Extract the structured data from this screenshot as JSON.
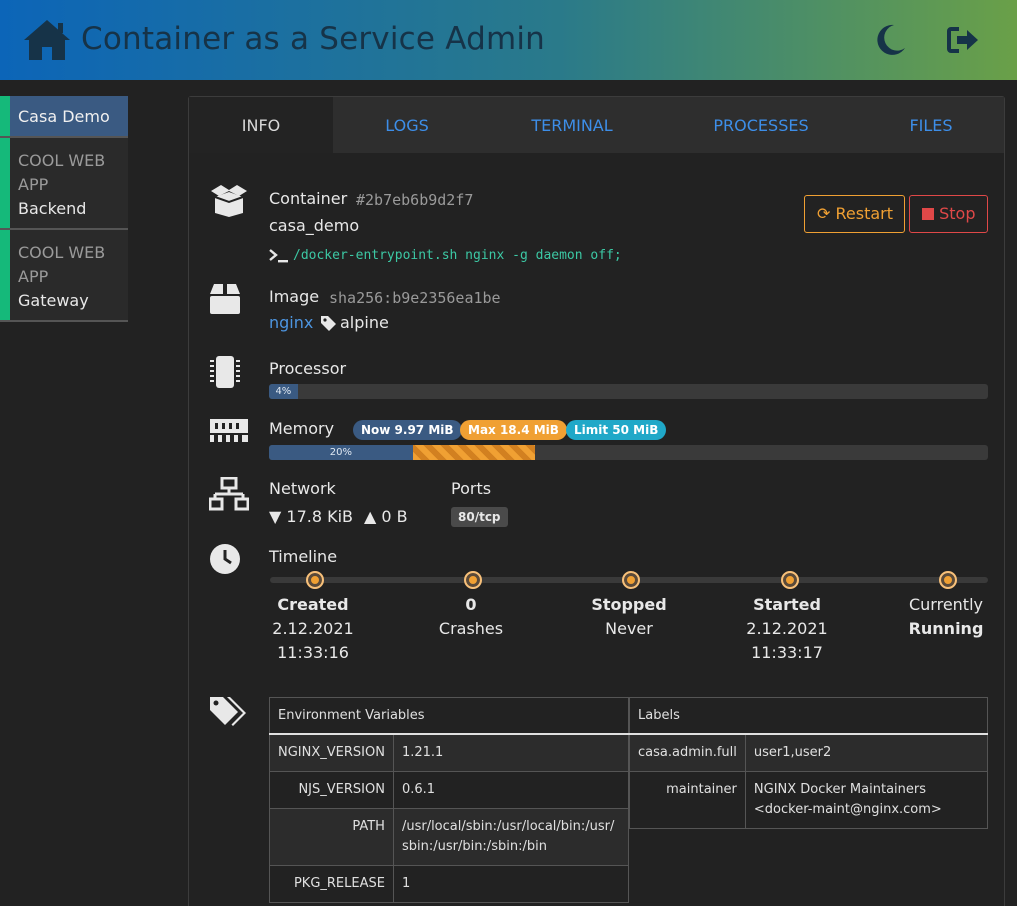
{
  "header": {
    "title": "Container as a Service Admin",
    "logo_icon": "home-icon",
    "theme_icon": "moon-icon",
    "logout_icon": "sign-out-icon"
  },
  "sidebar": {
    "items": [
      {
        "label": "Casa Demo",
        "active": true
      },
      {
        "top": "COOL WEB APP",
        "bottom": "Backend"
      },
      {
        "top": "COOL WEB APP",
        "bottom": "Gateway"
      }
    ]
  },
  "tabs": [
    "INFO",
    "LOGS",
    "TERMINAL",
    "PROCESSES",
    "FILES"
  ],
  "container": {
    "label": "Container",
    "id": "#2b7eb6b9d2f7",
    "name": "casa_demo",
    "command": "/docker-entrypoint.sh nginx -g daemon off;",
    "restart_label": "Restart",
    "stop_label": "Stop"
  },
  "image": {
    "label": "Image",
    "hash": "sha256:b9e2356ea1be",
    "repo": "nginx",
    "tag": "alpine"
  },
  "processor": {
    "label": "Processor",
    "percent_label": "4%",
    "percent": 4
  },
  "memory": {
    "label": "Memory",
    "now": "Now 9.97 MiB",
    "max": "Max 18.4 MiB",
    "limit": "Limit 50 MiB",
    "percent_label": "20%",
    "now_percent": 20,
    "max_percent": 37
  },
  "network": {
    "label": "Network",
    "rx": "17.8 KiB",
    "tx": "0 B",
    "ports_label": "Ports",
    "ports": [
      "80/tcp"
    ]
  },
  "timeline": {
    "label": "Timeline",
    "steps": [
      {
        "title": "Created",
        "line2": "2.12.2021",
        "line3": "11:33:16"
      },
      {
        "title": "0",
        "line2": "Crashes",
        "line3": ""
      },
      {
        "title": "Stopped",
        "line2": "Never",
        "line3": ""
      },
      {
        "title": "Started",
        "line2": "2.12.2021",
        "line3": "11:33:17"
      },
      {
        "title": "Currently",
        "line2": "Running",
        "line3": ""
      }
    ]
  },
  "env": {
    "header": "Environment Variables",
    "rows": [
      {
        "key": "NGINX_VERSION",
        "value": "1.21.1"
      },
      {
        "key": "NJS_VERSION",
        "value": "0.6.1"
      },
      {
        "key": "PATH",
        "value": "/usr/local/sbin:/usr/local/bin:/usr/sbin:/usr/bin:/sbin:/bin"
      },
      {
        "key": "PKG_RELEASE",
        "value": "1"
      }
    ]
  },
  "labels": {
    "header": "Labels",
    "rows": [
      {
        "key": "casa.admin.full",
        "value": "user1,user2"
      },
      {
        "key": "maintainer",
        "value": "NGINX Docker Maintainers <docker-maint@nginx.com>"
      }
    ]
  },
  "colors": {
    "accent_blue": "#3d8ee8",
    "sidebar_marker": "#15b97a",
    "warning": "#f0a033",
    "danger": "#e04848",
    "info": "#20a8c8",
    "bar_fill": "#3a5a82"
  }
}
